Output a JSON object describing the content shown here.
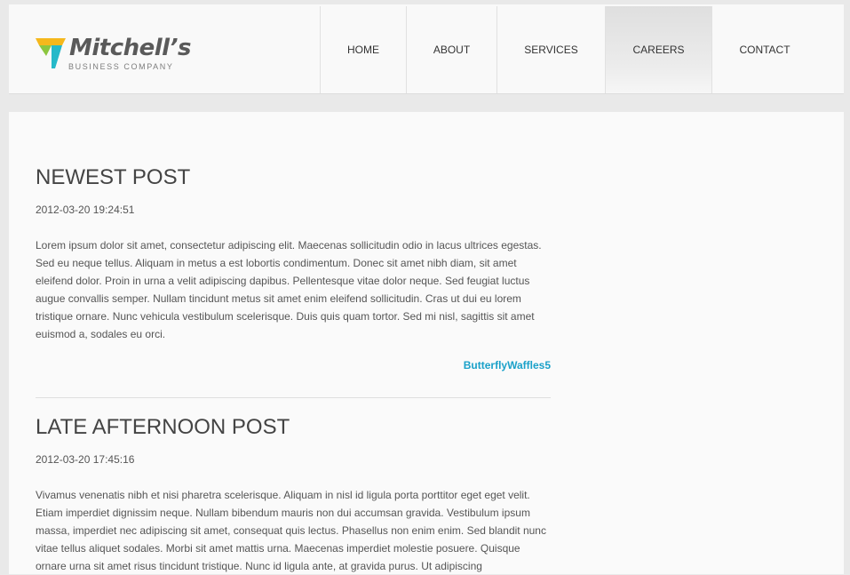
{
  "logo": {
    "title": "Mitchell’s",
    "subtitle": "BUSINESS COMPANY",
    "colors": [
      "#f5b81c",
      "#8cc63f",
      "#25b9c9"
    ]
  },
  "nav": {
    "items": [
      {
        "label": "HOME"
      },
      {
        "label": "ABOUT"
      },
      {
        "label": "SERVICES"
      },
      {
        "label": "CAREERS"
      },
      {
        "label": "CONTACT"
      }
    ],
    "active": "CAREERS"
  },
  "posts": [
    {
      "title": "NEWEST POST",
      "date": "2012-03-20 19:24:51",
      "body": "Lorem ipsum dolor sit amet, consectetur adipiscing elit. Maecenas sollicitudin odio in lacus ultrices egestas. Sed eu neque tellus. Aliquam in metus a est lobortis condimentum. Donec sit amet nibh diam, sit amet eleifend dolor. Proin in urna a velit adipiscing dapibus. Pellentesque vitae dolor neque. Sed feugiat luctus augue convallis semper. Nullam tincidunt metus sit amet enim eleifend sollicitudin. Cras ut dui eu lorem tristique ornare. Nunc vehicula vestibulum scelerisque. Duis quis quam tortor. Sed mi nisl, sagittis sit amet euismod a, sodales eu orci.",
      "author": "ButterflyWaffles5"
    },
    {
      "title": "LATE AFTERNOON POST",
      "date": "2012-03-20 17:45:16",
      "body": "Vivamus venenatis nibh et nisi pharetra scelerisque. Aliquam in nisl id ligula porta porttitor eget eget velit. Etiam imperdiet dignissim neque. Nullam bibendum mauris non dui accumsan gravida. Vestibulum ipsum massa, imperdiet nec adipiscing sit amet, consequat quis lectus. Phasellus non enim enim. Sed blandit nunc vitae tellus aliquet sodales. Morbi sit amet mattis urna. Maecenas imperdiet molestie posuere. Quisque ornare urna sit amet risus tincidunt tristique. Nunc id ligula ante, at gravida purus. Ut adipiscing"
    }
  ],
  "colors": {
    "accent": "#1aa1c9",
    "page_background": "#e9e9e9",
    "panel_background": "#fafafa"
  }
}
